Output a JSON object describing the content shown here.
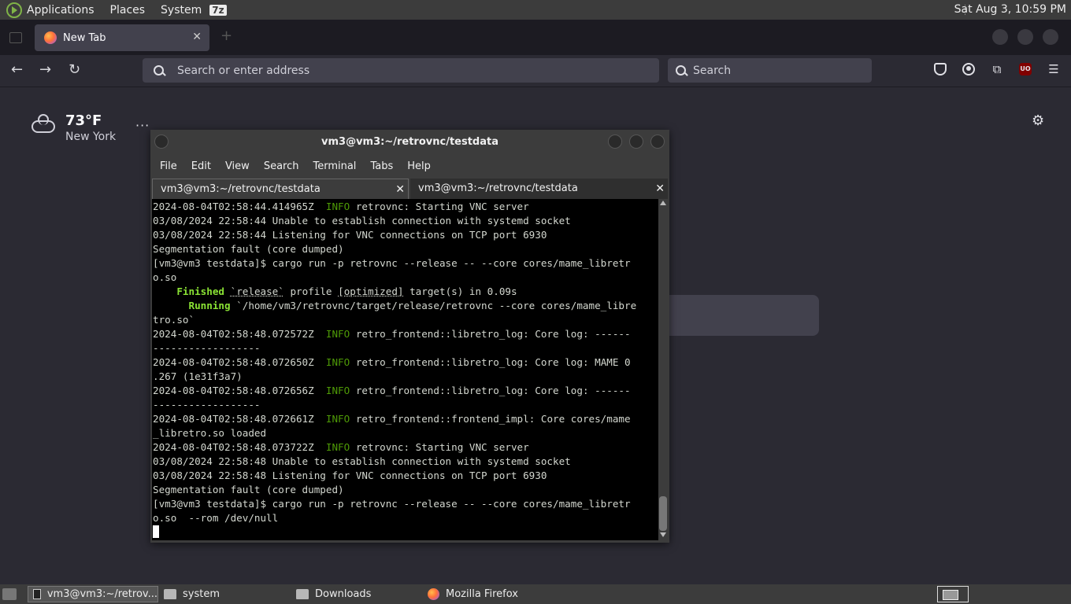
{
  "top_panel": {
    "menus": [
      "Applications",
      "Places",
      "System"
    ],
    "badge": "7z",
    "clock": "Sat Aug  3, 10:59 PM"
  },
  "browser": {
    "tab_title": "New Tab",
    "tab_close": "✕",
    "url_placeholder": "Search or enter address",
    "search_placeholder": "Search",
    "ublock_label": "UO"
  },
  "newtab": {
    "weather_temp": "73°F",
    "weather_city": "New York",
    "weather_more": "···"
  },
  "terminal": {
    "title": "vm3@vm3:~/retrovnc/testdata",
    "menu": [
      "File",
      "Edit",
      "View",
      "Search",
      "Terminal",
      "Tabs",
      "Help"
    ],
    "tabs": [
      "vm3@vm3:~/retrovnc/testdata",
      "vm3@vm3:~/retrovnc/testdata"
    ],
    "lines": [
      {
        "ts": "2024-08-04T02:58:44.414965Z",
        "level": "INFO",
        "target": "retrovnc:",
        "msg": " Starting VNC server"
      },
      {
        "text": "03/08/2024 22:58:44 Unable to establish connection with systemd socket"
      },
      {
        "text": "03/08/2024 22:58:44 Listening for VNC connections on TCP port 6930"
      },
      {
        "text": "Segmentation fault (core dumped)"
      },
      {
        "text": "[vm3@vm3 testdata]$ cargo run -p retrovnc --release -- --core cores/mame_libretr"
      },
      {
        "text": "o.so"
      },
      {
        "status": "Finished",
        "pre": " ",
        "quoted": "`release`",
        "rest": " profile ",
        "opt": "[optimized]",
        "tail": " target(s) in 0.09s"
      },
      {
        "status": "Running",
        "pre": "  ",
        "tail": " `/home/vm3/retrovnc/target/release/retrovnc --core cores/mame_libre"
      },
      {
        "text": "tro.so`"
      },
      {
        "ts": "2024-08-04T02:58:48.072572Z",
        "level": "INFO",
        "target": "retro_frontend::libretro_log:",
        "msg": " Core log: ------"
      },
      {
        "text": "------------------"
      },
      {
        "ts": "2024-08-04T02:58:48.072650Z",
        "level": "INFO",
        "target": "retro_frontend::libretro_log:",
        "msg": " Core log: MAME 0"
      },
      {
        "text": ".267 (1e31f3a7)"
      },
      {
        "ts": "2024-08-04T02:58:48.072656Z",
        "level": "INFO",
        "target": "retro_frontend::libretro_log:",
        "msg": " Core log: ------"
      },
      {
        "text": "------------------"
      },
      {
        "ts": "2024-08-04T02:58:48.072661Z",
        "level": "INFO",
        "target": "retro_frontend::frontend_impl:",
        "msg": " Core cores/mame"
      },
      {
        "text": "_libretro.so loaded"
      },
      {
        "ts": "2024-08-04T02:58:48.073722Z",
        "level": "INFO",
        "target": "retrovnc:",
        "msg": " Starting VNC server"
      },
      {
        "text": "03/08/2024 22:58:48 Unable to establish connection with systemd socket"
      },
      {
        "text": "03/08/2024 22:58:48 Listening for VNC connections on TCP port 6930"
      },
      {
        "text": "Segmentation fault (core dumped)"
      },
      {
        "text": "[vm3@vm3 testdata]$ cargo run -p retrovnc --release -- --core cores/mame_libretr"
      },
      {
        "text": "o.so  --rom /dev/null"
      }
    ]
  },
  "taskbar": {
    "items": [
      "vm3@vm3:~/retrov...",
      "system",
      "Downloads",
      "Mozilla Firefox"
    ]
  }
}
